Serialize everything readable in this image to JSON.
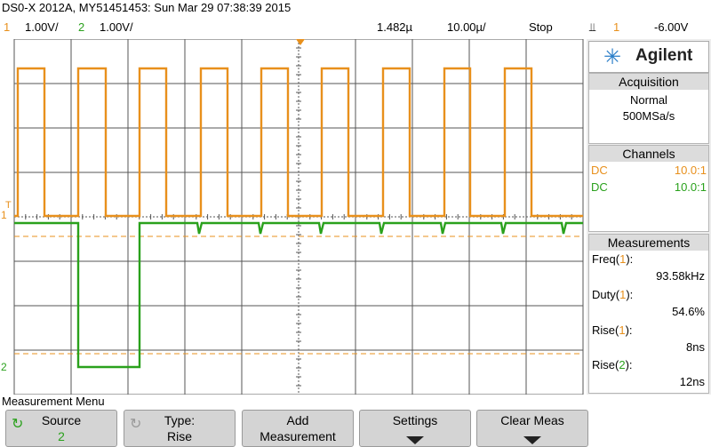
{
  "title": "DS0-X 2012A, MY51451453: Sun Mar 29 07:38:39 2015",
  "status": {
    "ch1_num": "1",
    "ch1_scale": "1.00V/",
    "ch2_num": "2",
    "ch2_scale": "1.00V/",
    "time_offset": "1.482µ",
    "timebase": "10.00µ/",
    "run_state": "Stop",
    "trigger_symbol": "⫫",
    "trigger_source": "1",
    "trigger_level": "-6.00V"
  },
  "brand": {
    "name": "Agilent",
    "logo_icon": "starburst-icon"
  },
  "acquisition": {
    "header": "Acquisition",
    "mode": "Normal",
    "rate": "500MSa/s"
  },
  "channels": {
    "header": "Channels",
    "rows": [
      {
        "coupling": "DC",
        "probe": "10.0:1",
        "color": "#e8901c"
      },
      {
        "coupling": "DC",
        "probe": "10.0:1",
        "color": "#2aa11c"
      }
    ]
  },
  "measurements": {
    "header": "Measurements",
    "items": [
      {
        "name": "Freq",
        "src": "1",
        "value": "93.58kHz"
      },
      {
        "name": "Duty",
        "src": "1",
        "value": "54.6%"
      },
      {
        "name": "Rise",
        "src": "1",
        "value": "8ns"
      },
      {
        "name": "Rise",
        "src": "2",
        "value": "12ns"
      }
    ]
  },
  "menu": {
    "title": "Measurement Menu",
    "softkeys": [
      {
        "l1": "Source",
        "l2": "2"
      },
      {
        "l1": "Type:",
        "l2": "Rise"
      },
      {
        "l1": "Add",
        "l2": "Measurement"
      },
      {
        "l1": "Settings",
        "l2": ""
      },
      {
        "l1": "Clear Meas",
        "l2": ""
      }
    ]
  },
  "markers": {
    "ch1": "1",
    "ch2": "2",
    "trigger": "T"
  },
  "colors": {
    "ch1": "#e8901c",
    "ch2": "#2aa11c",
    "grid": "#000000"
  }
}
